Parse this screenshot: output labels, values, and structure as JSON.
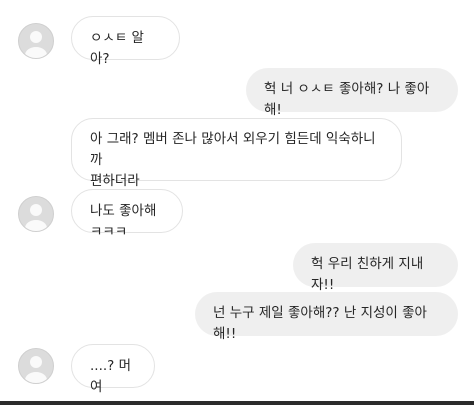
{
  "messages": [
    {
      "side": "in",
      "text": "ㅇㅅㅌ 알아?"
    },
    {
      "side": "out",
      "text": "헉 너 ㅇㅅㅌ 좋아해? 나 좋아해!"
    },
    {
      "side": "in",
      "text": "아 그래? 멤버 존나 많아서 외우기 힘든데 익숙하니까\n편하더라"
    },
    {
      "side": "in",
      "text": "나도 좋아해 ㅋㅋㅋ"
    },
    {
      "side": "out",
      "text": "헉 우리 친하게 지내자!!"
    },
    {
      "side": "out",
      "text": "넌 누구 제일 좋아해?? 난 지성이 좋아해!!"
    },
    {
      "side": "in",
      "text": "....? 머여"
    }
  ],
  "icons": {
    "avatar": "default-profile-avatar-icon"
  }
}
